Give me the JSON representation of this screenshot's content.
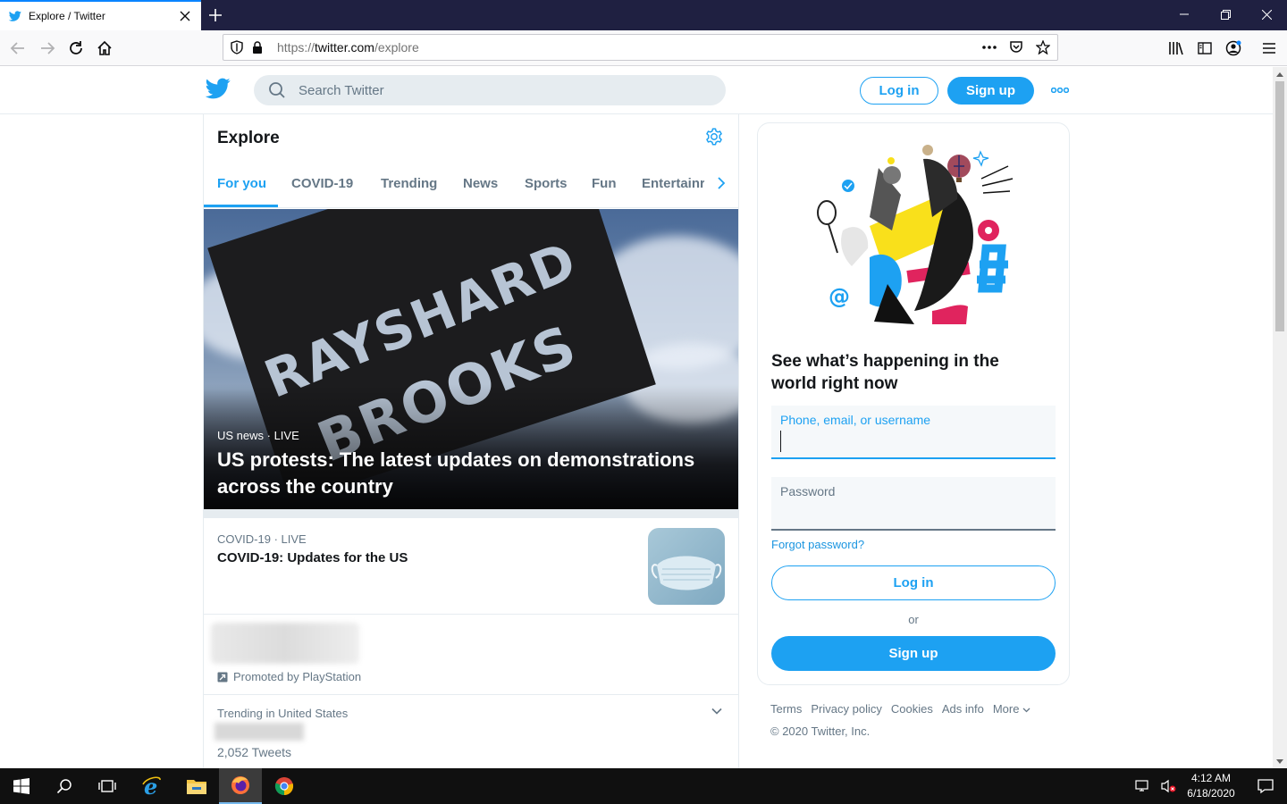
{
  "browser": {
    "tab_title": "Explore / Twitter",
    "url_scheme": "https://",
    "url_host": "twitter.com",
    "url_path": "/explore"
  },
  "header": {
    "search_placeholder": "Search Twitter",
    "login_label": "Log in",
    "signup_label": "Sign up"
  },
  "explore": {
    "title": "Explore",
    "tabs": [
      {
        "label": "For you"
      },
      {
        "label": "COVID-19"
      },
      {
        "label": "Trending"
      },
      {
        "label": "News"
      },
      {
        "label": "Sports"
      },
      {
        "label": "Fun"
      },
      {
        "label": "Entertainr"
      }
    ],
    "hero": {
      "graffiti_line1": "RAYSHARD",
      "graffiti_line2": "BROOKS",
      "meta": "US news · LIVE",
      "headline": "US protests: The latest updates on demonstrations across the country"
    },
    "story": {
      "meta": "COVID-19 · LIVE",
      "headline": "COVID-19: Updates for the US"
    },
    "promo": {
      "label": "Promoted by PlayStation"
    },
    "trend": {
      "meta": "Trending in United States",
      "count": "2,052 Tweets"
    }
  },
  "sidebar": {
    "title": "See what’s happening in the world right now",
    "phone_label": "Phone, email, or username",
    "password_label": "Password",
    "forgot": "Forgot password?",
    "login_label": "Log in",
    "or": "or",
    "signup_label": "Sign up"
  },
  "footer": {
    "links": [
      "Terms",
      "Privacy policy",
      "Cookies",
      "Ads info",
      "More"
    ],
    "copyright": "© 2020 Twitter, Inc."
  },
  "taskbar": {
    "time": "4:12 AM",
    "date": "6/18/2020"
  },
  "colors": {
    "brand": "#1da1f2",
    "firefox_tabbar": "#1f2041",
    "taskbar": "#101010"
  },
  "icons": [
    "twitter-logo-icon",
    "search-icon",
    "more-icon",
    "settings-icon",
    "chevron-right-icon",
    "chevron-down-icon",
    "promoted-icon"
  ]
}
